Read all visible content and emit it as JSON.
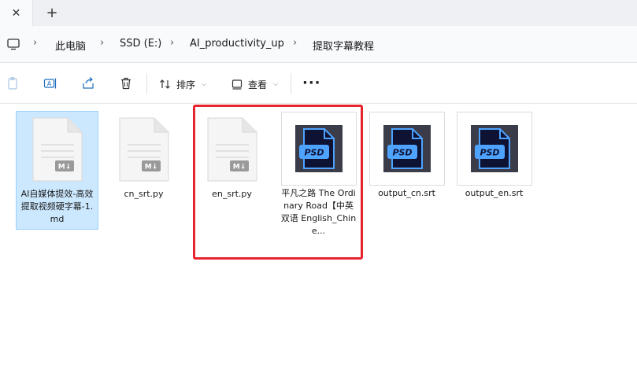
{
  "window": {
    "tab_close_glyph": "✕",
    "new_tab_glyph": "+"
  },
  "breadcrumb": {
    "items": [
      "此电脑",
      "SSD (E:)",
      "AI_productivity_up",
      "提取字幕教程"
    ],
    "separator": "›"
  },
  "toolbar": {
    "sort_label": "排序",
    "view_label": "查看",
    "more_label": "···"
  },
  "files": [
    {
      "name": "AI自媒体提效-高效提取视频硬字幕-1.md",
      "type": "markdown",
      "selected": true
    },
    {
      "name": "cn_srt.py",
      "type": "markdown",
      "selected": false
    },
    {
      "name": "en_srt.py",
      "type": "markdown",
      "selected": false
    },
    {
      "name": "平凡之路 The Ordinary Road【中英双语 English_Chine...",
      "type": "psd",
      "selected": false
    },
    {
      "name": "output_cn.srt",
      "type": "psd",
      "selected": false
    },
    {
      "name": "output_en.srt",
      "type": "psd",
      "selected": false
    }
  ],
  "file_labels": {
    "f0": "AI自媒体提效-高效提取视频硬字幕-1.md",
    "f1": "cn_srt.py",
    "f2": "en_srt.py",
    "f3": "平凡之路 The Ordinary Road【中英双语 English_Chine...",
    "f4": "output_cn.srt",
    "f5": "output_en.srt"
  },
  "icons": {
    "md_badge": "M↓",
    "psd_badge": "PSD"
  },
  "colors": {
    "selection_bg": "#cce8ff",
    "highlight_border": "#e8242e",
    "psd_dark": "#3b3c4a",
    "psd_blue": "#4ea3ff"
  }
}
